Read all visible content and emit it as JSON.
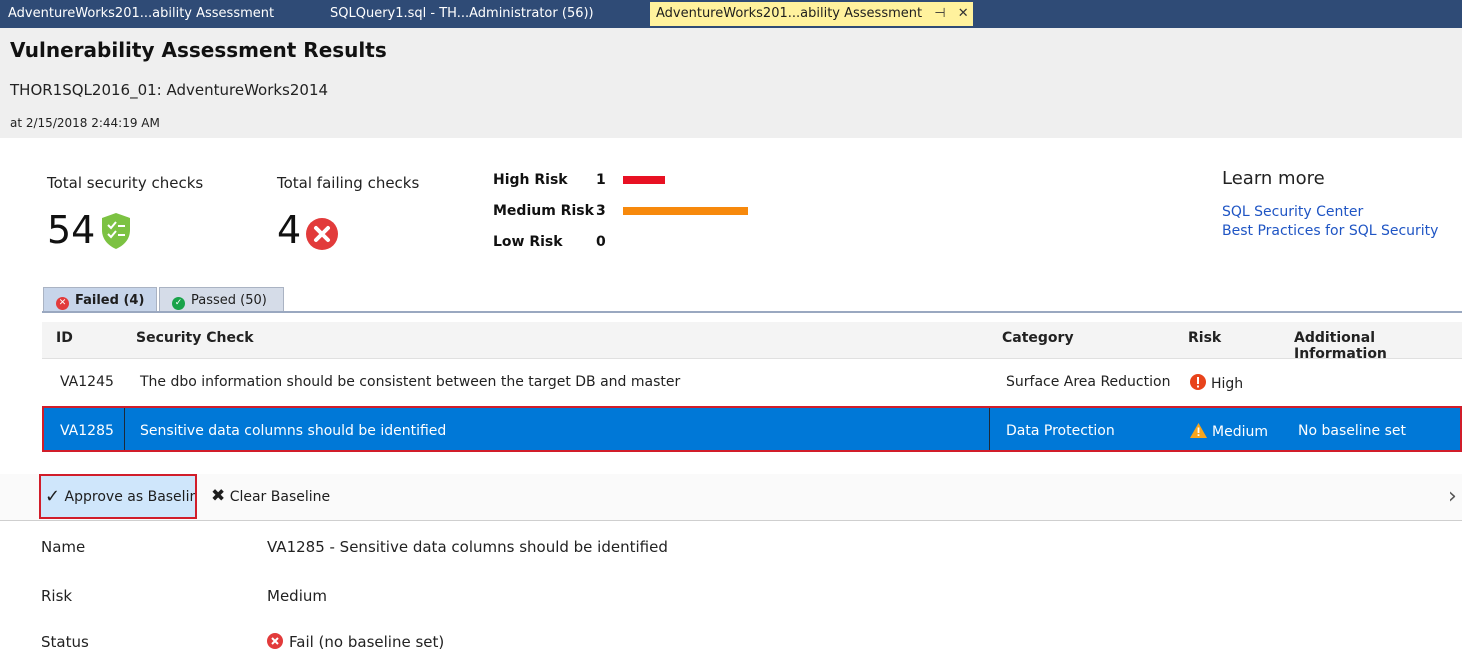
{
  "tabs": [
    {
      "label": "AdventureWorks201...ability Assessment"
    },
    {
      "label": "SQLQuery1.sql - TH...Administrator (56))"
    },
    {
      "label": "AdventureWorks201...ability Assessment",
      "pin": "⊣",
      "close": "✕"
    }
  ],
  "header": {
    "title": "Vulnerability Assessment Results",
    "server": "THOR1SQL2016_01: AdventureWorks2014",
    "timestamp": "at 2/15/2018 2:44:19 AM"
  },
  "summary": {
    "total_label": "Total security checks",
    "total_value": "54",
    "failing_label": "Total failing checks",
    "failing_value": "4",
    "risks": [
      {
        "label": "High Risk",
        "count": "1",
        "color": "#e81123",
        "level": 1
      },
      {
        "label": "Medium Risk",
        "count": "3",
        "color": "#f7890c",
        "level": 3
      },
      {
        "label": "Low Risk",
        "count": "0",
        "color": "#19a34a",
        "level": 0
      }
    ]
  },
  "learn_more": {
    "title": "Learn more",
    "links": [
      "SQL Security Center",
      "Best Practices for SQL Security"
    ]
  },
  "result_tabs": [
    {
      "label": "Failed",
      "count": "(4)"
    },
    {
      "label": "Passed",
      "count": "(50)"
    }
  ],
  "grid": {
    "columns": [
      "ID",
      "Security Check",
      "Category",
      "Risk",
      "Additional Information"
    ],
    "rows": [
      {
        "id": "VA1245",
        "check": "The dbo information should be consistent between the target DB and master",
        "category": "Surface Area Reduction",
        "risk": "High",
        "info": ""
      },
      {
        "id": "VA1285",
        "check": "Sensitive data columns should be identified",
        "category": "Data Protection",
        "risk": "Medium",
        "info": "No baseline set"
      }
    ]
  },
  "toolbar": {
    "approve_label": "Approve as Baseline",
    "clear_label": "Clear Baseline"
  },
  "details": [
    {
      "label": "Name",
      "value": "VA1285 - Sensitive data columns should be identified"
    },
    {
      "label": "Risk",
      "value": "Medium"
    },
    {
      "label": "Status",
      "value": "Fail (no baseline set)"
    }
  ],
  "colors": {
    "selected_row": "#0078d7",
    "highlight_border": "#d11d2a",
    "link": "#1f55c4"
  }
}
